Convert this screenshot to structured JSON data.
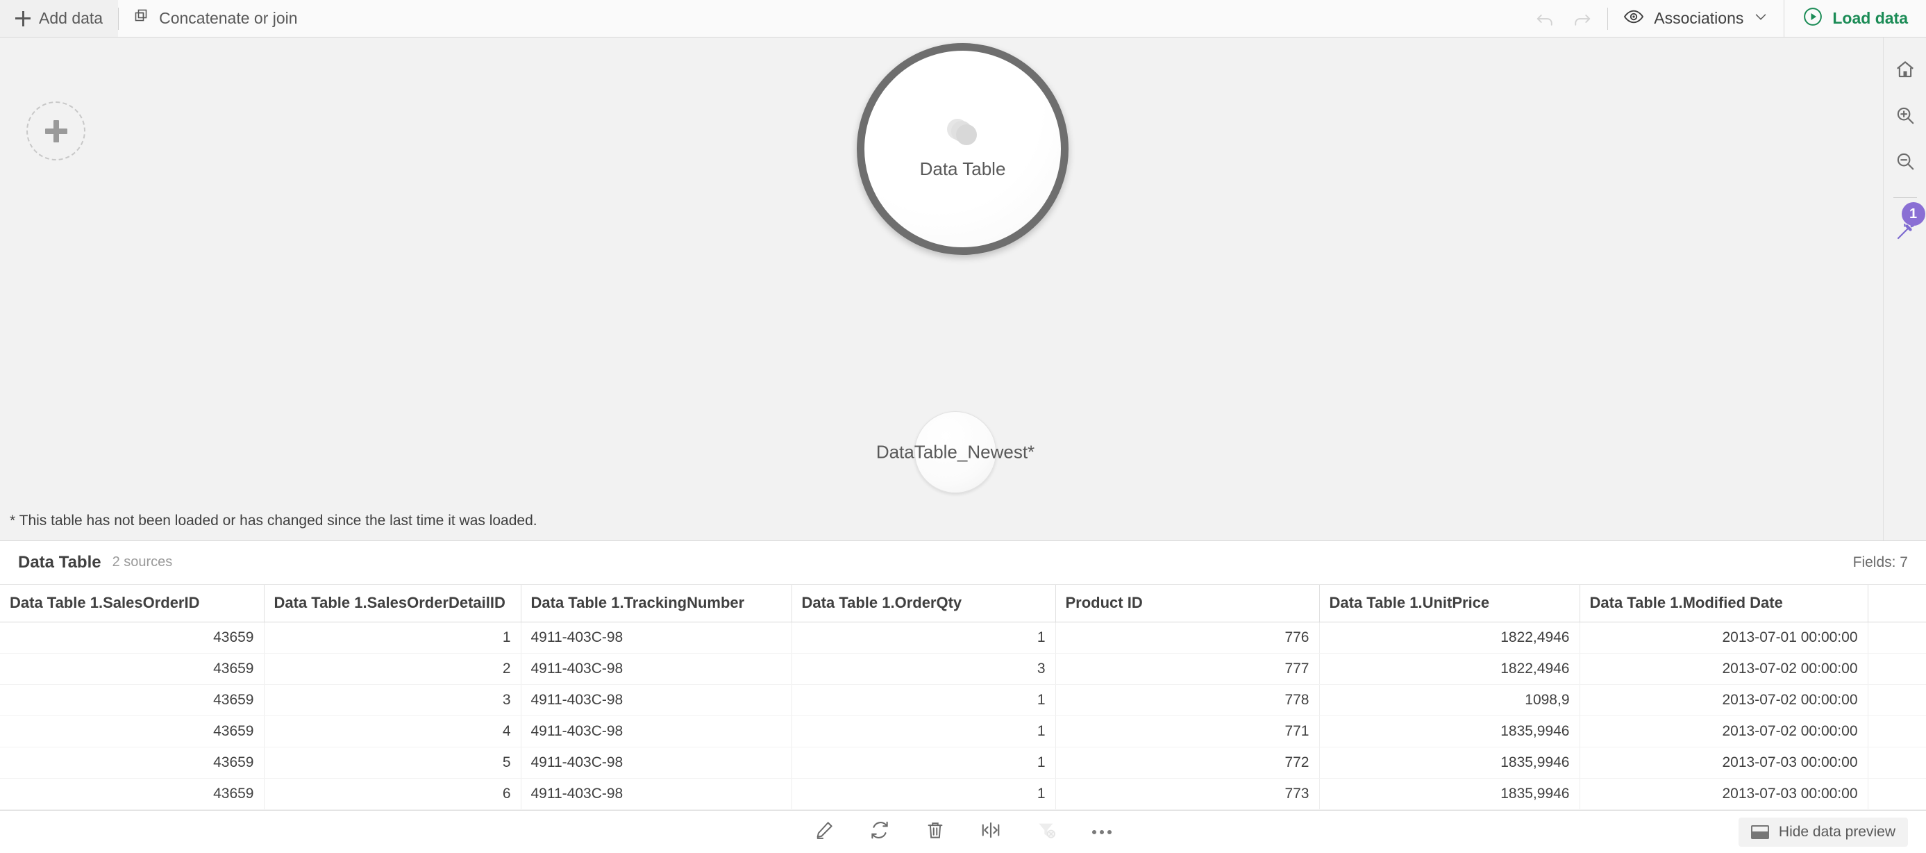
{
  "toolbar": {
    "add_data_label": "Add data",
    "concatenate_label": "Concatenate or join",
    "associations_label": "Associations",
    "load_data_label": "Load data",
    "accent_green": "#1a8b55"
  },
  "canvas": {
    "add_source_tooltip": "Add data",
    "bubbles": [
      {
        "label": "Data Table",
        "state": "loaded"
      },
      {
        "label": "DataTable_Newest*",
        "state": "not-loaded"
      }
    ],
    "footnote": "* This table has not been loaded or has changed since the last time it was loaded."
  },
  "rail": {
    "badge_count": "1",
    "badge_color": "#8a6fd4",
    "items": [
      {
        "name": "home-icon"
      },
      {
        "name": "zoom-in-icon"
      },
      {
        "name": "zoom-out-icon"
      },
      {
        "name": "magic-wand-icon"
      }
    ]
  },
  "preview": {
    "title": "Data Table",
    "sources": "2 sources",
    "fields": "Fields: 7",
    "columns": [
      "Data Table 1.SalesOrderID",
      "Data Table 1.SalesOrderDetailID",
      "Data Table 1.TrackingNumber",
      "Data Table 1.OrderQty",
      "Product ID",
      "Data Table 1.UnitPrice",
      "Data Table 1.Modified Date"
    ],
    "rows": [
      [
        "43659",
        "1",
        "4911-403C-98",
        "1",
        "776",
        "1822,4946",
        "2013-07-01 00:00:00"
      ],
      [
        "43659",
        "2",
        "4911-403C-98",
        "3",
        "777",
        "1822,4946",
        "2013-07-02 00:00:00"
      ],
      [
        "43659",
        "3",
        "4911-403C-98",
        "1",
        "778",
        "1098,9",
        "2013-07-02 00:00:00"
      ],
      [
        "43659",
        "4",
        "4911-403C-98",
        "1",
        "771",
        "1835,9946",
        "2013-07-02 00:00:00"
      ],
      [
        "43659",
        "5",
        "4911-403C-98",
        "1",
        "772",
        "1835,9946",
        "2013-07-03 00:00:00"
      ],
      [
        "43659",
        "6",
        "4911-403C-98",
        "1",
        "773",
        "1835,9946",
        "2013-07-03 00:00:00"
      ]
    ],
    "column_align": [
      "num",
      "num",
      "txt",
      "num",
      "num",
      "num",
      "num"
    ]
  },
  "bottombar": {
    "buttons": [
      {
        "name": "edit-icon"
      },
      {
        "name": "refresh-icon"
      },
      {
        "name": "delete-icon"
      },
      {
        "name": "resize-columns-icon"
      },
      {
        "name": "clear-filter-icon"
      },
      {
        "name": "more-options-icon"
      }
    ],
    "hide_preview_label": "Hide data preview"
  }
}
